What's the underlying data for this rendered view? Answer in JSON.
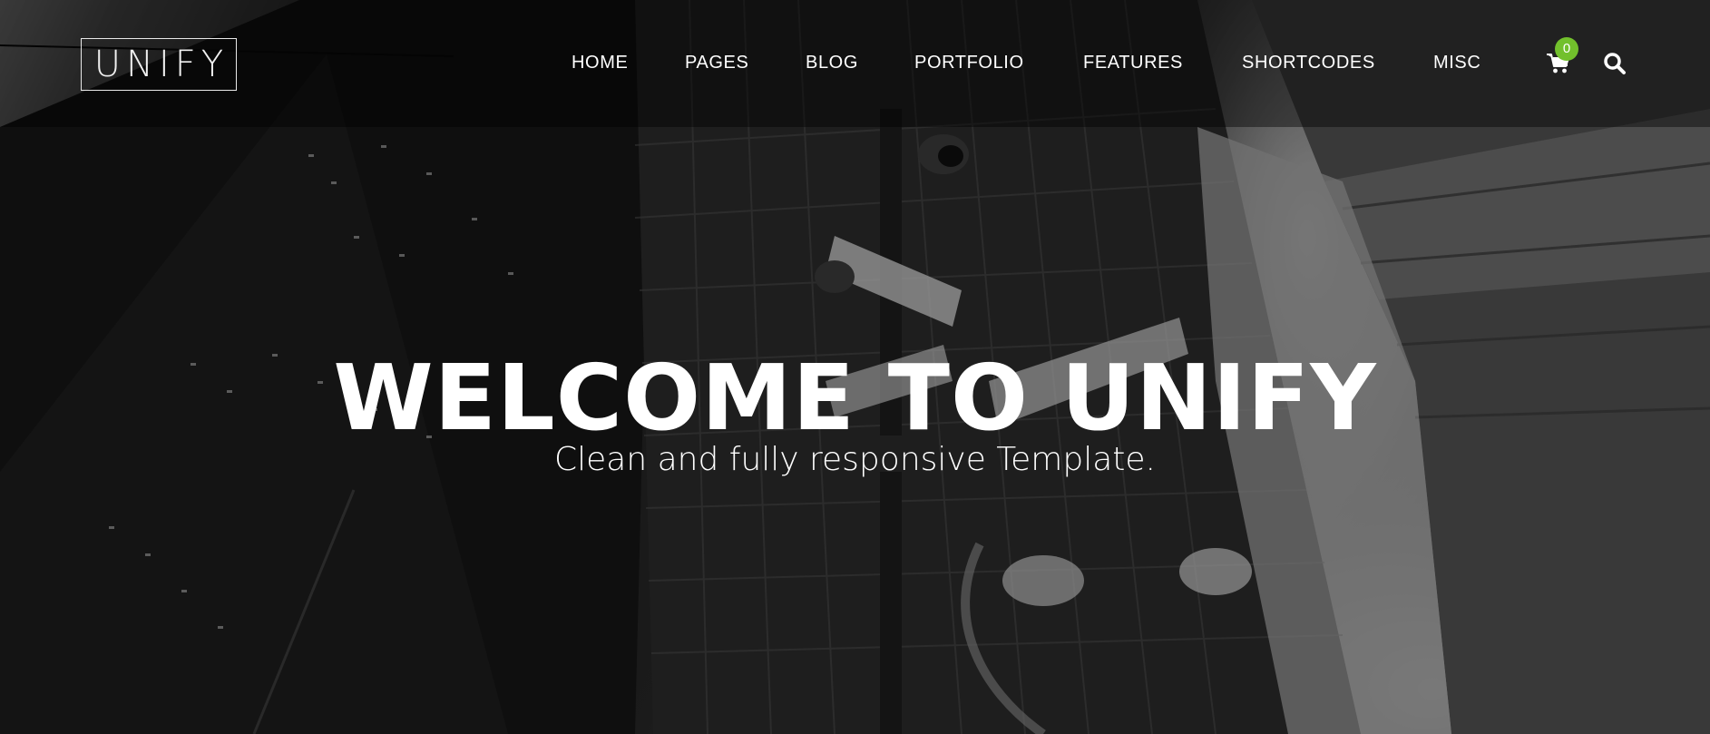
{
  "brand": {
    "logo_text": "UNIFY"
  },
  "nav": {
    "items": [
      {
        "label": "HOME"
      },
      {
        "label": "PAGES"
      },
      {
        "label": "BLOG"
      },
      {
        "label": "PORTFOLIO"
      },
      {
        "label": "FEATURES"
      },
      {
        "label": "SHORTCODES"
      },
      {
        "label": "MISC"
      }
    ],
    "cart_count": "0",
    "cart_icon": "shopping-cart-icon",
    "search_icon": "search-icon"
  },
  "hero": {
    "title": "WELCOME TO UNIFY",
    "subtitle": "Clean and fully responsive Template."
  },
  "colors": {
    "accent": "#72c02c",
    "header_bg": "rgba(0,0,0,0.42)",
    "text": "#ffffff"
  }
}
